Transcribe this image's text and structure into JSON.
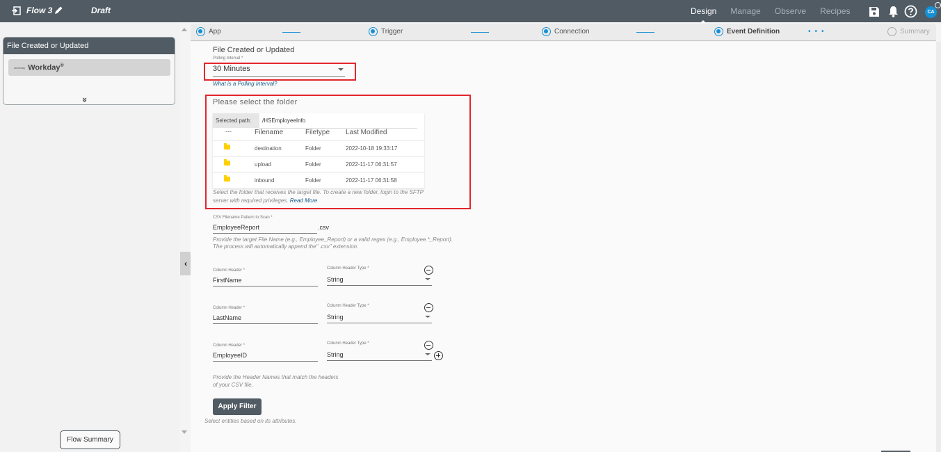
{
  "topbar": {
    "flow_name": "Flow 3",
    "status": "Draft",
    "nav": [
      "Design",
      "Manage",
      "Observe",
      "Recipes"
    ],
    "active_nav": "Design",
    "avatar_initials": "CA"
  },
  "sidebar": {
    "card_title": "File Created or Updated",
    "app_logo_text": "workday",
    "app_name": "Workday",
    "app_trademark": "®",
    "expand_glyph": "»",
    "flow_summary_label": "Flow Summary",
    "collapse_glyph": "‹"
  },
  "stepper": {
    "steps": [
      {
        "label": "App",
        "state": "done"
      },
      {
        "label": "Trigger",
        "state": "done"
      },
      {
        "label": "Connection",
        "state": "done"
      },
      {
        "label": "Event Definition",
        "state": "current"
      },
      {
        "label": "Summary",
        "state": "pending"
      }
    ],
    "dots": "•••"
  },
  "form": {
    "title": "File Created or Updated",
    "polling": {
      "label": "Polling Interval *",
      "value": "30 Minutes",
      "help_link": "What is a Polling Interval?"
    },
    "folder": {
      "heading": "Please select the folder",
      "selected_path_label": "Selected path:",
      "selected_path": "/HSEmployeeInfo",
      "columns": [
        "---",
        "Filename",
        "Filetype",
        "Last Modified"
      ],
      "rows": [
        {
          "name": "destination",
          "type": "Folder",
          "modified": "2022-10-18 19:33:17"
        },
        {
          "name": "upload",
          "type": "Folder",
          "modified": "2022-11-17 06:31:57"
        },
        {
          "name": "inbound",
          "type": "Folder",
          "modified": "2022-11-17 06:31:58"
        }
      ],
      "help_line1": "Select the folder that receives the target file. To create a new folder, login to the SFTP",
      "help_line2": "server with required privileges.",
      "read_more": "Read More"
    },
    "csv": {
      "label": "CSV Filename Pattern to Scan *",
      "value": "EmployeeReport",
      "suffix": ".csv",
      "help_line1": "Provide the target File Name (e.g., Employee_Report) or a valid regex (e.g., Employee.*_Report).",
      "help_line2": "The process will automatically append the\" .csv\" extension."
    },
    "columns": [
      {
        "header_label": "Column Header *",
        "header_value": "FirstName",
        "type_label": "Column Header Type *",
        "type_value": "String"
      },
      {
        "header_label": "Column Header *",
        "header_value": "LastName",
        "type_label": "Column Header Type *",
        "type_value": "String"
      },
      {
        "header_label": "Column Header *",
        "header_value": "EmployeeID",
        "type_label": "Column Header Type *",
        "type_value": "String"
      }
    ],
    "columns_help_line1": "Provide the Header Names that match the headers",
    "columns_help_line2": "of your CSV file.",
    "apply_filter_label": "Apply Filter",
    "apply_filter_help": "Select entities based on its attributes."
  },
  "colors": {
    "topbar": "#505b64",
    "accent": "#1590d6",
    "highlight": "#e2262c",
    "folder": "#ffd000"
  }
}
